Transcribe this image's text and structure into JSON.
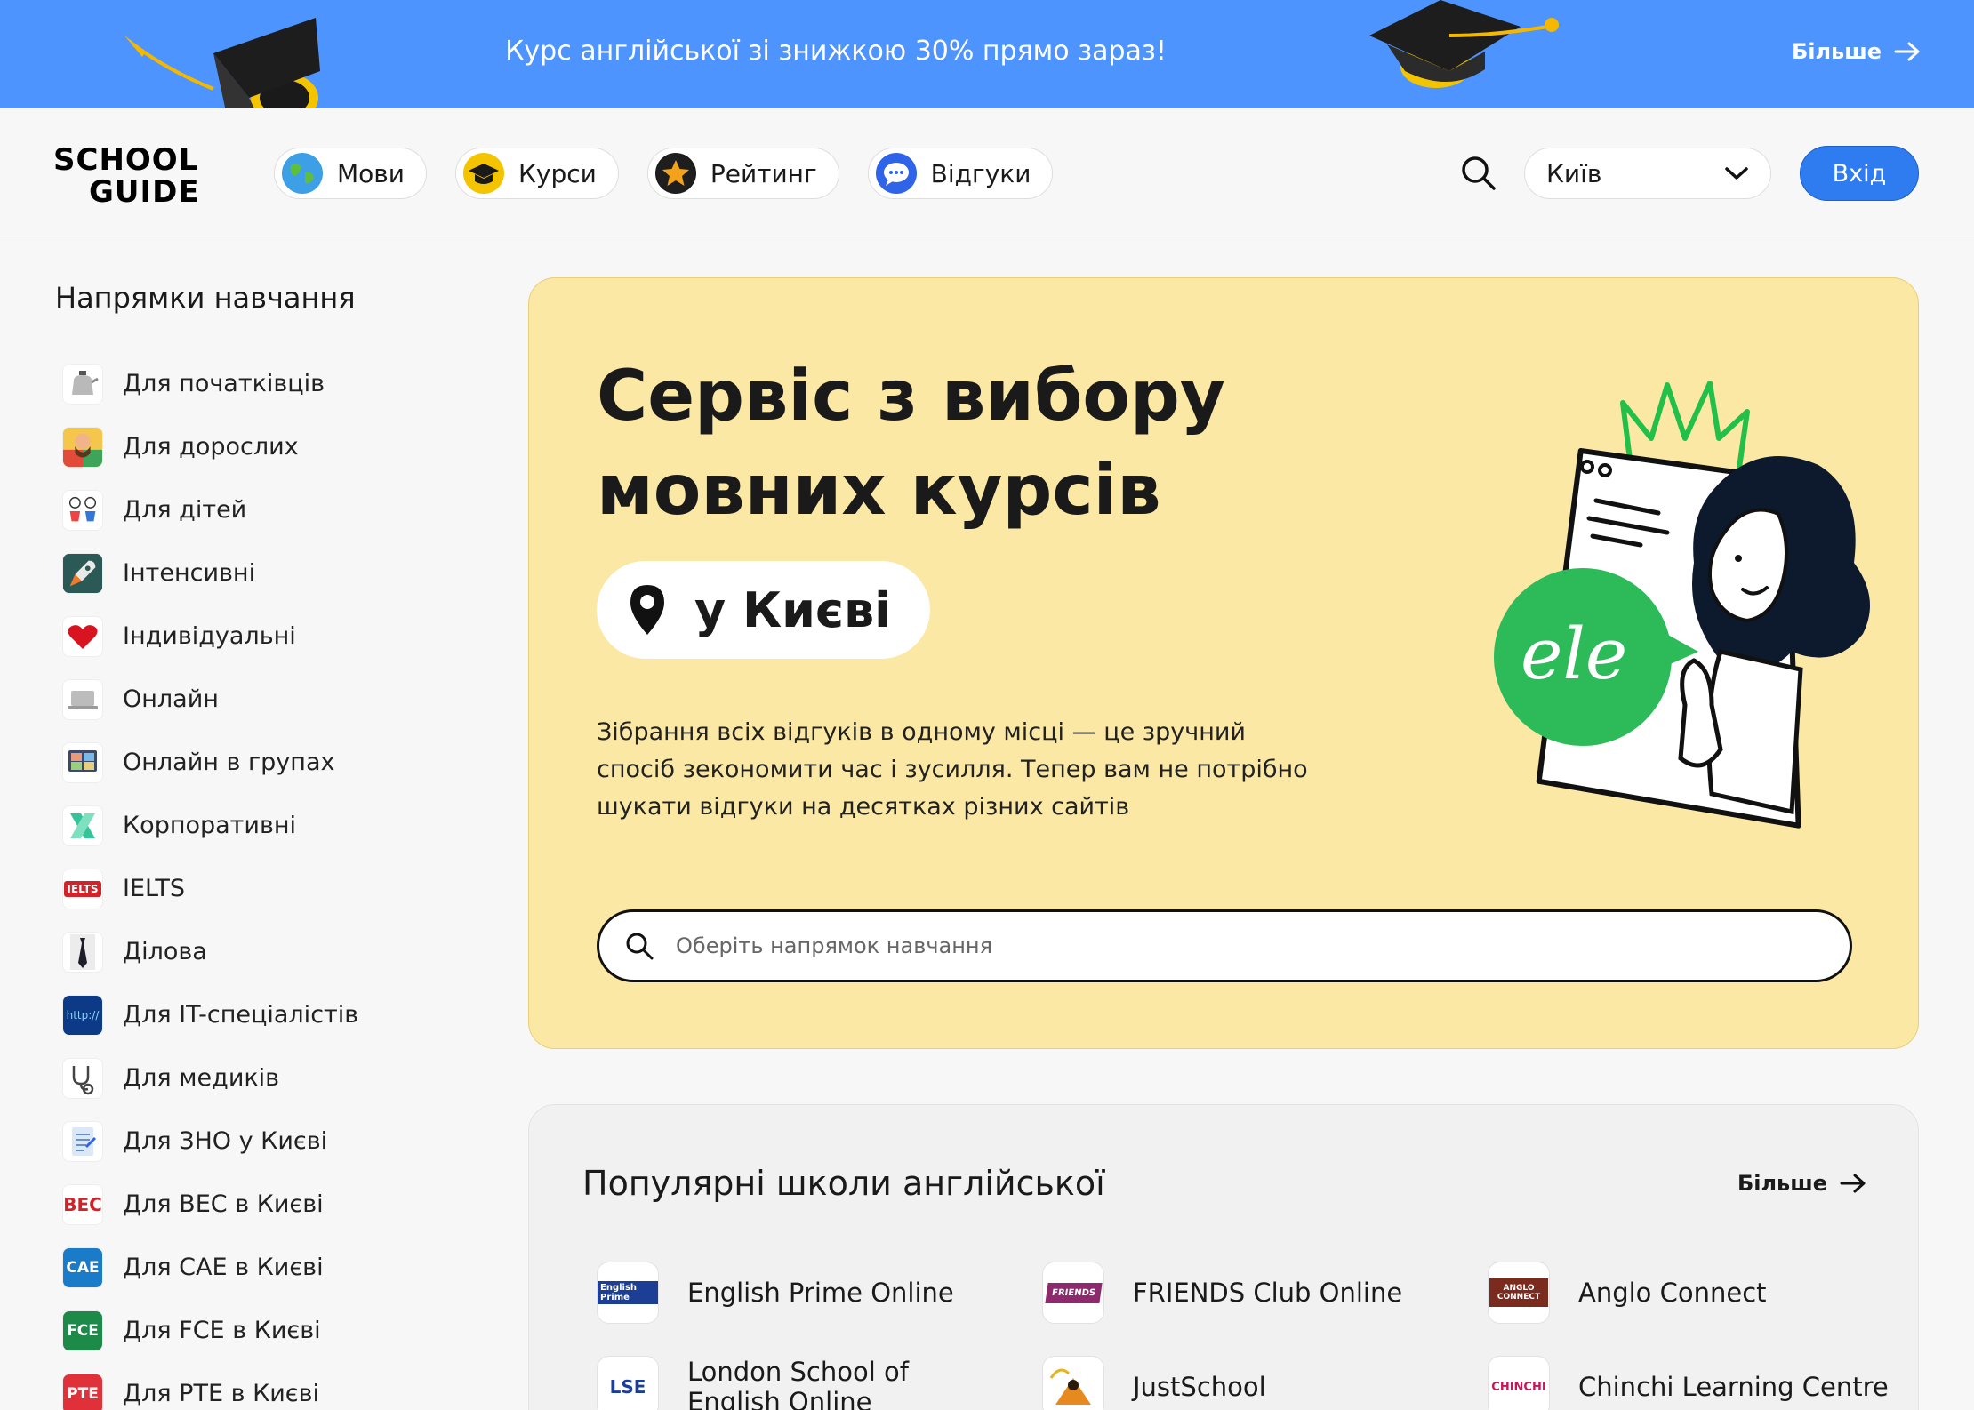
{
  "promo": {
    "text": "Курс англійської зі знижкою 30% прямо зараз!",
    "more_label": "Більше"
  },
  "header": {
    "logo_line1": "SCHOOL",
    "logo_line2": "GUIDE",
    "nav": [
      {
        "label": "Мови",
        "icon": "globe-icon"
      },
      {
        "label": "Курси",
        "icon": "graduation-cap-icon"
      },
      {
        "label": "Рейтинг",
        "icon": "star-icon"
      },
      {
        "label": "Відгуки",
        "icon": "chat-bubble-icon"
      }
    ],
    "city": "Київ",
    "login_label": "Вхід"
  },
  "sidebar": {
    "title": "Напрямки навчання",
    "items": [
      {
        "label": "Для початківців",
        "icon": "kettle-icon"
      },
      {
        "label": "Для дорослих",
        "icon": "adult-icon"
      },
      {
        "label": "Для дітей",
        "icon": "kids-icon"
      },
      {
        "label": "Інтенсивні",
        "icon": "rocket-icon"
      },
      {
        "label": "Індивідуальні",
        "icon": "heart-icon"
      },
      {
        "label": "Онлайн",
        "icon": "laptop-icon"
      },
      {
        "label": "Онлайн в групах",
        "icon": "video-group-icon"
      },
      {
        "label": "Корпоративні",
        "icon": "corporate-icon"
      },
      {
        "label": "IELTS",
        "icon": "ielts-icon",
        "badge": "IELTS"
      },
      {
        "label": "Ділова",
        "icon": "tie-icon"
      },
      {
        "label": "Для IT-спеціалістів",
        "icon": "http-icon",
        "badge": "http://"
      },
      {
        "label": "Для медиків",
        "icon": "stethoscope-icon"
      },
      {
        "label": "Для ЗНО у Києві",
        "icon": "test-sheet-icon"
      },
      {
        "label": "Для BEC в Києві",
        "icon": "bec-icon",
        "badge": "BEC"
      },
      {
        "label": "Для CAE в Києві",
        "icon": "cae-icon",
        "badge": "CAE"
      },
      {
        "label": "Для FCE в Києві",
        "icon": "fce-icon",
        "badge": "FCE"
      },
      {
        "label": "Для PTE в Києві",
        "icon": "pte-icon",
        "badge": "PTE"
      }
    ]
  },
  "hero": {
    "title_line1": "Сервіс з вибору",
    "title_line2": "мовних курсів",
    "location": "у Києві",
    "description": "Зібрання всіх відгуків в одному місці — це зручний спосіб зекономити час і зусилля. Тепер вам не потрібно шукати відгуки на десятках різних сайтів",
    "search_placeholder": "Оберіть напрямок навчання",
    "bubble_text": "ele",
    "accent_green": "#2dbb5a"
  },
  "popular": {
    "title": "Популярні школи англійської",
    "more_label": "Більше",
    "schools": [
      {
        "name": "English Prime Online",
        "logo_text": "English Prime"
      },
      {
        "name": "FRIENDS Club Online",
        "logo_text": "FRIENDS"
      },
      {
        "name": "Anglo Connect",
        "logo_text": "ANGLO CONNECT"
      },
      {
        "name": "London School of English Online",
        "logo_text": "LSE"
      },
      {
        "name": "JustSchool",
        "logo_text": ""
      },
      {
        "name": "Chinchi Learning Centre",
        "logo_text": "CHINCHI"
      }
    ]
  },
  "colors": {
    "banner": "#4d94ff",
    "login_button": "#2f7cf0",
    "hero_bg": "#fae8a4"
  }
}
